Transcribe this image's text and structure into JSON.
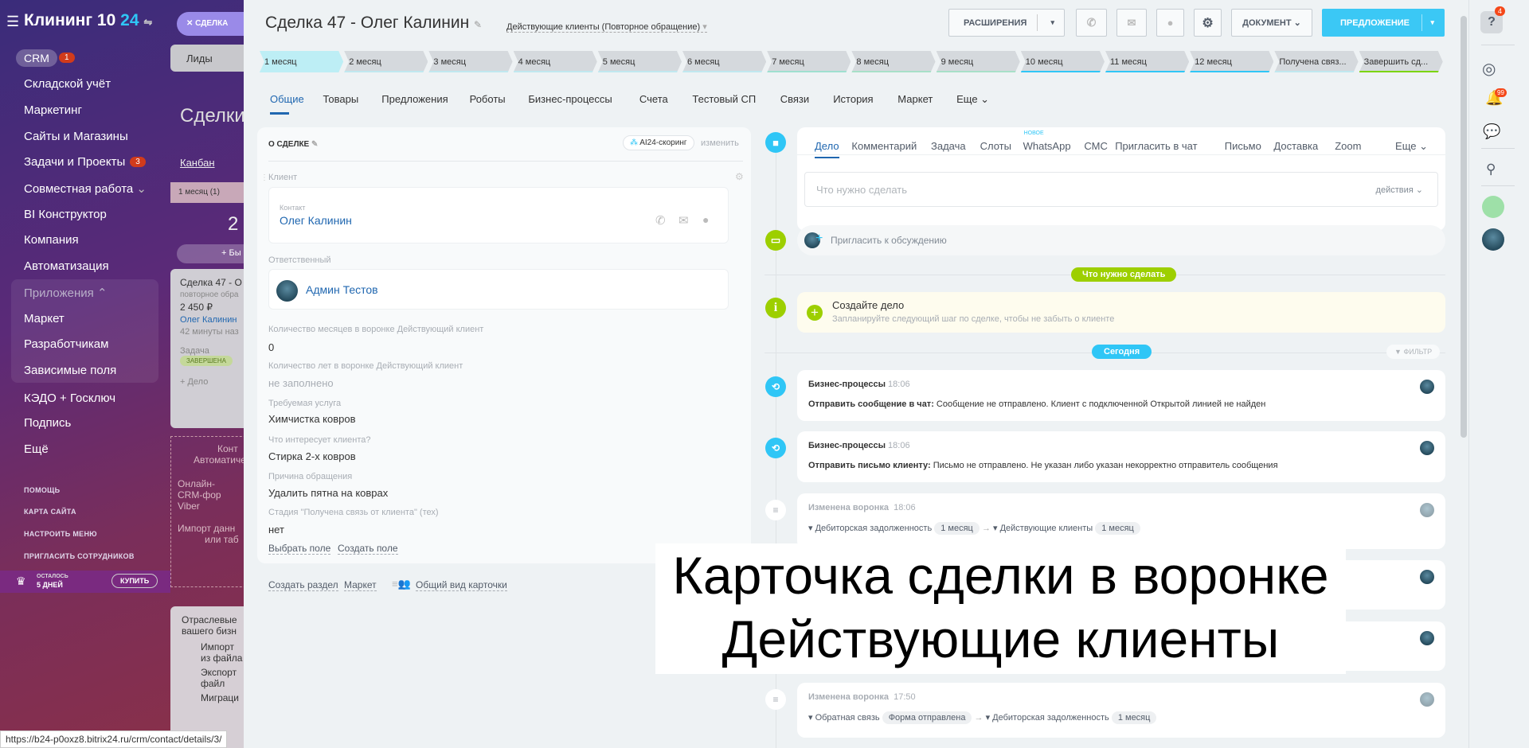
{
  "sidebar": {
    "title": "Клининг 10",
    "title_accent": "24",
    "crm": "CRM",
    "crm_badge": "1",
    "items": [
      "Складской учёт",
      "Маркетинг",
      "Сайты и Магазины",
      "Задачи и Проекты",
      "Совместная работа",
      "BI Конструктор",
      "Компания",
      "Автоматизация"
    ],
    "tasks_badge": "3",
    "apps_group": "Приложения",
    "apps": [
      "Маркет",
      "Разработчикам",
      "Зависимые поля"
    ],
    "items2": [
      "КЭДО + Госключ",
      "Подпись",
      "Ещё"
    ],
    "small": [
      "ПОМОЩЬ",
      "КАРТА САЙТА",
      "НАСТРОИТЬ МЕНЮ",
      "ПРИГЛАСИТЬ СОТРУДНИКОВ"
    ],
    "trial_top": "ОСТАЛОСЬ",
    "trial_days": "5 ДНЕЙ",
    "buy": "КУПИТЬ"
  },
  "background": {
    "close_label": "СДЕЛКА",
    "leads": "Лиды",
    "deals": "Сделки",
    "kanban": "Канбан",
    "column": "1 месяц (1)",
    "count": "2",
    "add": "+ Бы",
    "deal": "Сделка 47 - О",
    "deal_sub": "повторное обра",
    "price": "2 450 ₽",
    "contact": "Олег Калинин",
    "time": "42 минуты наз",
    "task": "Задача",
    "task_status": "ЗАВЕРШЕНА",
    "add_task": "+ Дело",
    "promo1": "Конт",
    "promo2": "Автоматичес",
    "promo_items": [
      "Онлайн-",
      "CRM-фор",
      "Viber"
    ],
    "import": "Импорт данн",
    "import2": "или таб",
    "industry1": "Отраслевые",
    "industry2": "вашего бизн",
    "actions": [
      "Импорт",
      "из файла",
      "Экспорт",
      "файл",
      "Миграци"
    ]
  },
  "status_url": "https://b24-p0oxz8.bitrix24.ru/crm/contact/details/3/",
  "header": {
    "title": "Сделка 47 - Олег Калинин",
    "funnel": "Действующие клиенты (Повторное обращение)",
    "extensions": "РАСШИРЕНИЯ",
    "document": "ДОКУМЕНТ",
    "proposal": "ПРЕДЛОЖЕНИЕ"
  },
  "stages": [
    "1 месяц",
    "2 месяц",
    "3 месяц",
    "4 месяц",
    "5 месяц",
    "6 месяц",
    "7 месяц",
    "8 месяц",
    "9 месяц",
    "10 месяц",
    "11 месяц",
    "12 месяц",
    "Получена связ...",
    "Завершить сд..."
  ],
  "current_stage": "1 месяц",
  "tabs": [
    "Общие",
    "Товары",
    "Предложения",
    "Роботы",
    "Бизнес-процессы",
    "Счета",
    "Тестовый СП",
    "Связи",
    "История",
    "Маркет",
    "Еще"
  ],
  "about": {
    "title": "О СДЕЛКЕ",
    "scoring": "AI24-скоринг",
    "change": "изменить",
    "client_label": "Клиент",
    "contact_label": "Контакт",
    "contact_name": "Олег Калинин",
    "responsible_label": "Ответственный",
    "responsible": "Админ Тестов",
    "fields": [
      {
        "label": "Количество месяцев в воронке Действующий клиент",
        "value": "0"
      },
      {
        "label": "Количество лет в воронке Действующий клиент",
        "value": "не заполнено"
      },
      {
        "label": "Требуемая услуга",
        "value": "Химчистка ковров"
      },
      {
        "label": "Что интересует клиента?",
        "value": "Стирка 2-х ковров"
      },
      {
        "label": "Причина обращения",
        "value": "Удалить пятна на коврах"
      },
      {
        "label": "Стадия \"Получена связь от клиента\" (тех)",
        "value": "нет"
      }
    ],
    "select_field": "Выбрать поле",
    "create_field": "Создать поле"
  },
  "bottom_links": {
    "create_section": "Создать раздел",
    "market": "Маркет",
    "common_view": "Общий вид карточки"
  },
  "timeline": {
    "tabs": [
      "Дело",
      "Комментарий",
      "Задача",
      "Слоты",
      "WhatsApp",
      "СМС",
      "Пригласить в чат",
      "Письмо",
      "Доставка",
      "Zoom"
    ],
    "new_badge": "НОВОЕ",
    "more": "Еще",
    "placeholder": "Что нужно сделать",
    "actions": "действия",
    "invite": "Пригласить к обсуждению",
    "todo_badge": "Что нужно сделать",
    "create_title": "Создайте дело",
    "create_sub": "Запланируйте следующий шаг по сделке, чтобы не забыть о клиенте",
    "today": "Сегодня",
    "filter": "ФИЛЬТР",
    "events": [
      {
        "title": "Бизнес-процессы",
        "time": "18:06",
        "bold": "Отправить сообщение в чат:",
        "text": "Сообщение не отправлено. Клиент с подключенной Открытой линией не найден"
      },
      {
        "title": "Бизнес-процессы",
        "time": "18:06",
        "bold": "Отправить письмо клиенту:",
        "text": "Письмо не отправлено. Не указан либо указан некорректно отправитель сообщения"
      }
    ],
    "funnel_changes": [
      {
        "title": "Изменена воронка",
        "time": "18:06",
        "from": "Дебиторская задолженность",
        "from_stage": "1 месяц",
        "to": "Действующие клиенты",
        "to_stage": "1 месяц"
      },
      {
        "title": "Изменена воронка",
        "time": "17:50",
        "from": "Обратная связь",
        "from_stage": "Форма отправлена",
        "to": "Дебиторская задолженность",
        "to_stage": "1 месяц"
      }
    ]
  },
  "right_bar": {
    "help_badge": "4",
    "notif_badge": "99"
  },
  "overlay": {
    "line1": "Карточка сделки в воронке",
    "line2": "Действующие клиенты"
  },
  "colors": {
    "accent": "#3bc8f5",
    "green": "#9dcf00",
    "stage_current": "#bdeef5",
    "link": "#2067b0"
  }
}
